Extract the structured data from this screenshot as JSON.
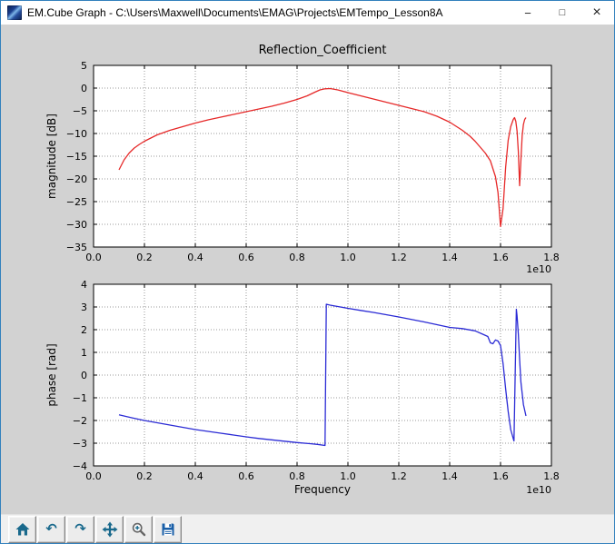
{
  "window": {
    "title": "EM.Cube Graph - C:\\Users\\Maxwell\\Documents\\EMAG\\Projects\\EMTempo_Lesson8A",
    "controls": {
      "minimize": "−",
      "maximize": "□",
      "close": "×"
    }
  },
  "toolbar": {
    "buttons": [
      "home",
      "back",
      "forward",
      "pan",
      "zoom",
      "save"
    ],
    "back_glyph": "↶",
    "forward_glyph": "↷"
  },
  "colors": {
    "window_border": "#3381bd",
    "figure_bg": "#d2d2d2",
    "toolbar_bg": "#f0f0f0",
    "icon_teal": "#19698c",
    "icon_blue": "#1a5fa8",
    "grid": "#999999",
    "magnitude_line": "#e62929",
    "phase_line": "#2b2bd5"
  },
  "chart_data": [
    {
      "type": "line",
      "title": "Reflection_Coefficient",
      "xlabel": "",
      "ylabel": "magnitude [dB]",
      "x_offset_label": "1e10",
      "x_unit_scale": 10000000000,
      "xlim": [
        0.0,
        1.8
      ],
      "ylim": [
        -35,
        5
      ],
      "xticks": [
        "0.0",
        "0.2",
        "0.4",
        "0.6",
        "0.8",
        "1.0",
        "1.2",
        "1.4",
        "1.6",
        "1.8"
      ],
      "yticks": [
        5,
        0,
        -5,
        -10,
        -15,
        -20,
        -25,
        -30,
        -35
      ],
      "grid": true,
      "legend": null,
      "series": [
        {
          "name": "magnitude",
          "color": "#e62929",
          "points": [
            [
              0.1,
              -18.0
            ],
            [
              0.12,
              -15.8
            ],
            [
              0.14,
              -14.3
            ],
            [
              0.16,
              -13.2
            ],
            [
              0.18,
              -12.4
            ],
            [
              0.2,
              -11.7
            ],
            [
              0.25,
              -10.3
            ],
            [
              0.3,
              -9.3
            ],
            [
              0.35,
              -8.5
            ],
            [
              0.4,
              -7.7
            ],
            [
              0.45,
              -7.0
            ],
            [
              0.5,
              -6.4
            ],
            [
              0.55,
              -5.8
            ],
            [
              0.6,
              -5.2
            ],
            [
              0.65,
              -4.6
            ],
            [
              0.7,
              -4.0
            ],
            [
              0.75,
              -3.3
            ],
            [
              0.8,
              -2.5
            ],
            [
              0.84,
              -1.7
            ],
            [
              0.87,
              -0.9
            ],
            [
              0.89,
              -0.4
            ],
            [
              0.91,
              -0.15
            ],
            [
              0.93,
              -0.1
            ],
            [
              0.96,
              -0.4
            ],
            [
              1.0,
              -1.0
            ],
            [
              1.05,
              -1.7
            ],
            [
              1.1,
              -2.4
            ],
            [
              1.15,
              -3.1
            ],
            [
              1.2,
              -3.8
            ],
            [
              1.25,
              -4.5
            ],
            [
              1.3,
              -5.2
            ],
            [
              1.35,
              -6.2
            ],
            [
              1.4,
              -7.5
            ],
            [
              1.45,
              -9.3
            ],
            [
              1.48,
              -10.6
            ],
            [
              1.5,
              -11.7
            ],
            [
              1.52,
              -13.0
            ],
            [
              1.54,
              -14.3
            ],
            [
              1.56,
              -16.0
            ],
            [
              1.58,
              -19.5
            ],
            [
              1.59,
              -23.0
            ],
            [
              1.6,
              -30.5
            ],
            [
              1.61,
              -26.5
            ],
            [
              1.62,
              -17.5
            ],
            [
              1.63,
              -11.5
            ],
            [
              1.64,
              -8.5
            ],
            [
              1.65,
              -6.9
            ],
            [
              1.655,
              -6.5
            ],
            [
              1.66,
              -7.3
            ],
            [
              1.665,
              -9.5
            ],
            [
              1.67,
              -14.0
            ],
            [
              1.675,
              -21.5
            ],
            [
              1.68,
              -16.0
            ],
            [
              1.685,
              -10.5
            ],
            [
              1.69,
              -8.0
            ],
            [
              1.695,
              -6.9
            ],
            [
              1.7,
              -6.5
            ]
          ]
        }
      ]
    },
    {
      "type": "line",
      "title": "",
      "xlabel": "Frequency",
      "ylabel": "phase [rad]",
      "x_offset_label": "1e10",
      "x_unit_scale": 10000000000,
      "xlim": [
        0.0,
        1.8
      ],
      "ylim": [
        -4,
        4
      ],
      "xticks": [
        "0.0",
        "0.2",
        "0.4",
        "0.6",
        "0.8",
        "1.0",
        "1.2",
        "1.4",
        "1.6",
        "1.8"
      ],
      "yticks": [
        4,
        3,
        2,
        1,
        0,
        -1,
        -2,
        -3,
        -4
      ],
      "grid": true,
      "legend": null,
      "series": [
        {
          "name": "phase",
          "color": "#2b2bd5",
          "points": [
            [
              0.1,
              -1.75
            ],
            [
              0.15,
              -1.88
            ],
            [
              0.2,
              -2.0
            ],
            [
              0.25,
              -2.1
            ],
            [
              0.3,
              -2.2
            ],
            [
              0.35,
              -2.3
            ],
            [
              0.4,
              -2.4
            ],
            [
              0.45,
              -2.48
            ],
            [
              0.5,
              -2.56
            ],
            [
              0.55,
              -2.64
            ],
            [
              0.6,
              -2.72
            ],
            [
              0.65,
              -2.79
            ],
            [
              0.7,
              -2.85
            ],
            [
              0.75,
              -2.91
            ],
            [
              0.8,
              -2.97
            ],
            [
              0.85,
              -3.02
            ],
            [
              0.88,
              -3.05
            ],
            [
              0.91,
              -3.1
            ],
            [
              0.915,
              3.12
            ],
            [
              0.93,
              3.08
            ],
            [
              0.96,
              3.02
            ],
            [
              1.0,
              2.94
            ],
            [
              1.05,
              2.85
            ],
            [
              1.1,
              2.76
            ],
            [
              1.15,
              2.66
            ],
            [
              1.2,
              2.56
            ],
            [
              1.25,
              2.45
            ],
            [
              1.3,
              2.34
            ],
            [
              1.35,
              2.22
            ],
            [
              1.4,
              2.1
            ],
            [
              1.45,
              2.05
            ],
            [
              1.5,
              1.95
            ],
            [
              1.53,
              1.8
            ],
            [
              1.55,
              1.7
            ],
            [
              1.56,
              1.42
            ],
            [
              1.57,
              1.38
            ],
            [
              1.58,
              1.55
            ],
            [
              1.59,
              1.5
            ],
            [
              1.6,
              1.3
            ],
            [
              1.61,
              0.5
            ],
            [
              1.62,
              -0.6
            ],
            [
              1.63,
              -1.6
            ],
            [
              1.64,
              -2.4
            ],
            [
              1.65,
              -2.8
            ],
            [
              1.653,
              -2.9
            ],
            [
              1.662,
              2.9
            ],
            [
              1.665,
              2.6
            ],
            [
              1.67,
              1.8
            ],
            [
              1.675,
              0.7
            ],
            [
              1.68,
              -0.3
            ],
            [
              1.69,
              -1.3
            ],
            [
              1.7,
              -1.8
            ]
          ]
        }
      ]
    }
  ]
}
